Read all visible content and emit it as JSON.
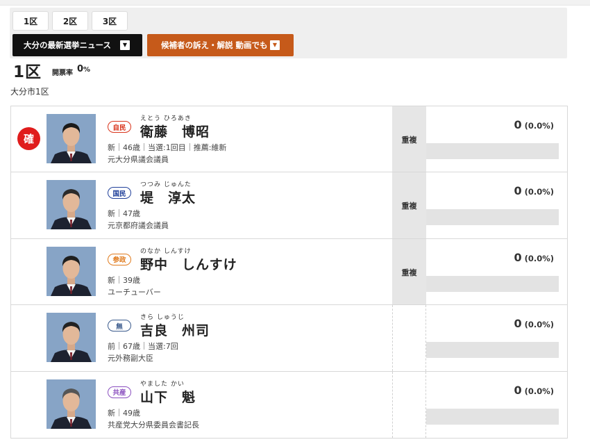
{
  "district_tabs": [
    "1区",
    "2区",
    "3区"
  ],
  "news_buttons": {
    "latest_news": "大分の最新選挙ニュース",
    "candidate_videos": "候補者の訴え・解説 動画でも"
  },
  "district": {
    "title": "1区",
    "count_label": "開票率",
    "count_value": "0",
    "count_unit": "%",
    "area": "大分市1区"
  },
  "colors": {
    "elected": "#e01c1c",
    "orange_button": "#c65a1a",
    "bar_bg": "#e3e3e3"
  },
  "candidates": [
    {
      "elected_mark": "確",
      "party": "自民",
      "party_color": "#d9331a",
      "kana": "えとう ひろあき",
      "name": "衛藤　博昭",
      "status": "新",
      "age": "46歳",
      "extra": [
        "当選:1回目",
        "推薦:維新"
      ],
      "career": "元大分県議会議員",
      "duplicate": "重複",
      "votes": "0",
      "percent": "(0.0%)",
      "vote_share": 0
    },
    {
      "elected_mark": "",
      "party": "国民",
      "party_color": "#1f3f9a",
      "kana": "つつみ じゅんた",
      "name": "堤　淳太",
      "status": "新",
      "age": "47歳",
      "extra": [],
      "career": "元京都府議会議員",
      "duplicate": "重複",
      "votes": "0",
      "percent": "(0.0%)",
      "vote_share": 0
    },
    {
      "elected_mark": "",
      "party": "参政",
      "party_color": "#e07a1c",
      "kana": "のなか しんすけ",
      "name": "野中　しんすけ",
      "status": "新",
      "age": "39歳",
      "extra": [],
      "career": "ユーチューバー",
      "duplicate": "重複",
      "votes": "0",
      "percent": "(0.0%)",
      "vote_share": 0
    },
    {
      "elected_mark": "",
      "party": "無",
      "party_color": "#3a5a8c",
      "kana": "きら しゅうじ",
      "name": "吉良　州司",
      "status": "前",
      "age": "67歳",
      "extra": [
        "当選:7回"
      ],
      "career": "元外務副大臣",
      "duplicate": "",
      "votes": "0",
      "percent": "(0.0%)",
      "vote_share": 0
    },
    {
      "elected_mark": "",
      "party": "共産",
      "party_color": "#8a4fbf",
      "kana": "やました かい",
      "name": "山下　魁",
      "status": "新",
      "age": "49歳",
      "extra": [],
      "career": "共産党大分県委員会書記長",
      "duplicate": "",
      "votes": "0",
      "percent": "(0.0%)",
      "vote_share": 0
    }
  ]
}
